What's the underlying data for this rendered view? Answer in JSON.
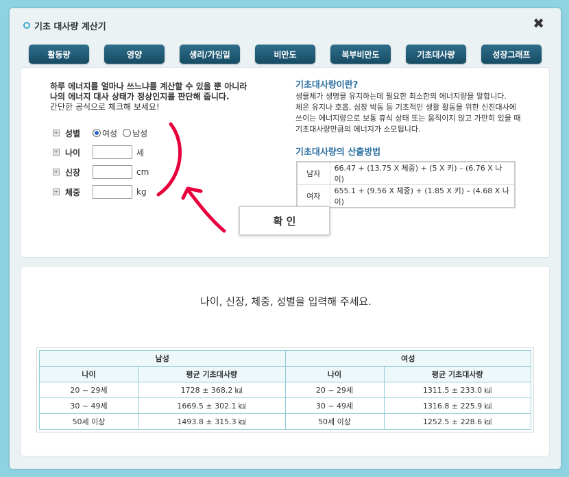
{
  "window": {
    "title": "기초 대사량 계산기",
    "close": "✖"
  },
  "tabs": [
    "활동량",
    "영양",
    "생리/가임일",
    "비만도",
    "복부비만도",
    "기초대사량",
    "성장그래프"
  ],
  "intro": {
    "line1": "하루 에너지를 얼마나 쓰느냐를 계산할 수 있을 뿐 아니라",
    "line2": "나의 에너지 대사 상태가 정상인지를 판단해 줍니다.",
    "line3": "간단한 공식으로 체크해 보세요!"
  },
  "form": {
    "gender_label": "성별",
    "gender_options": [
      "여성",
      "남성"
    ],
    "gender_selected": "여성",
    "age_label": "나이",
    "age_unit": "세",
    "age_value": "",
    "height_label": "신장",
    "height_unit": "cm",
    "height_value": "",
    "weight_label": "체중",
    "weight_unit": "kg",
    "weight_value": ""
  },
  "info": {
    "title": "기초대사량이란?",
    "lines": [
      "생물체가 생명을 유지하는데 필요한 최소한의 에너지량을 말합니다.",
      "체온 유지나 호흡, 심장 박동 등 기초적인 생활 활동을 위한 신진대사에",
      "쓰이는 에너지량으로 보통 휴식 상태 또는 움직이지 않고 가만히 있을 때",
      "기초대사량만큼의 에너지가 소모됩니다."
    ],
    "method_title": "기초대사량의 산출방법",
    "formulas": [
      {
        "gender": "남자",
        "formula": "66.47 + (13.75 X 체중) + (5 X 키) – (6.76 X 나이)"
      },
      {
        "gender": "여자",
        "formula": "655.1 + (9.56 X 체중) + (1.85 X 키) – (4.68 X 나이)"
      }
    ]
  },
  "confirm_label": "확 인",
  "result_message": "나이, 신장, 체중, 성별을 입력해 주세요.",
  "stats": {
    "male_header": "남성",
    "female_header": "여성",
    "col_age": "나이",
    "col_avg": "평균 기초대사량",
    "rows": [
      {
        "m_age": "20 ~ 29세",
        "m_val": "1728 ± 368.2 ㎉",
        "f_age": "20 ~ 29세",
        "f_val": "1311.5 ± 233.0 ㎉"
      },
      {
        "m_age": "30 ~ 49세",
        "m_val": "1669.5 ± 302.1 ㎉",
        "f_age": "30 ~ 49세",
        "f_val": "1316.8 ± 225.9 ㎉"
      },
      {
        "m_age": "50세 이상",
        "m_val": "1493.8 ± 315.3 ㎉",
        "f_age": "50세 이상",
        "f_val": "1252.5 ± 228.6 ㎉"
      }
    ]
  },
  "colors": {
    "tab_bg": "#1f5a76",
    "accent": "#2a6fa0",
    "table_border": "#8ecbd8",
    "annotation": "#e8003c"
  }
}
